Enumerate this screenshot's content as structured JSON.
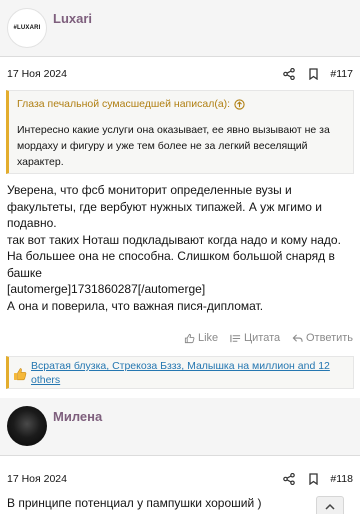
{
  "post1": {
    "username": "Luxari",
    "avatar_text": "#LUXARI",
    "date": "17 Ноя 2024",
    "number": "#117",
    "quote": {
      "header": "Глаза печальной сумасшедшей написал(а):",
      "text": "Интересно какие услуги она оказывает, ее явно вызывают не за мордаху и фигуру и уже тем более не за легкий веселящий характер."
    },
    "body": "Уверена, что фсб мониторит определенные вузы и факультеты, где вербуют нужных типажей. А уж мгимо и подавно.\nтак вот таких Ноташ подкладывают когда надо и кому надо. На большее она не способна. Слишком большой снаряд в башке\n[automerge]1731860287[/automerge]\nА она и поверила, что важная пися-дипломат.",
    "actions": {
      "like": "Like",
      "quote": "Цитата",
      "reply": "Ответить"
    },
    "reactions": "Всратая блузка, Стрекоза Бззз, Малышка на миллион and 12 others"
  },
  "post2": {
    "username": "Милена",
    "date": "17 Ноя 2024",
    "number": "#118",
    "body": "В принципе потенциал у пампушки хороший )"
  },
  "colors": {
    "accent": "#e3ad2d",
    "username": "#7e5f7d",
    "link": "#2577b1",
    "quote_header": "#b07f12"
  },
  "icons": [
    "share-icon",
    "bookmark-icon",
    "arrow-up-circle-icon",
    "like-icon",
    "quote-icon",
    "reply-icon",
    "thumbs-up-icon",
    "chevron-up-icon"
  ]
}
